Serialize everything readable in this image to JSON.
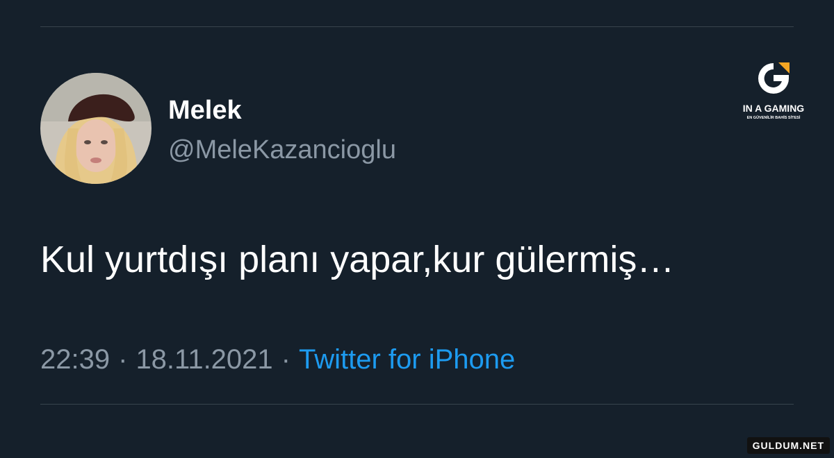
{
  "user": {
    "display_name": "Melek",
    "handle": "@MeleKazancioglu"
  },
  "tweet": {
    "text": "Kul yurtdışı planı yapar,kur gülermiş…",
    "time": "22:39",
    "separator": "·",
    "date": "18.11.2021",
    "source": "Twitter for iPhone"
  },
  "logo": {
    "title": "IN A GAMING",
    "subtitle": "EN GÜVENİLİR BAHİS SİTESİ"
  },
  "watermark": {
    "text": "GULDUM.NET"
  },
  "colors": {
    "background": "#15202b",
    "divider": "#38444d",
    "secondary_text": "#8b98a5",
    "link": "#1d9bf0",
    "logo_accent": "#f5a623"
  }
}
